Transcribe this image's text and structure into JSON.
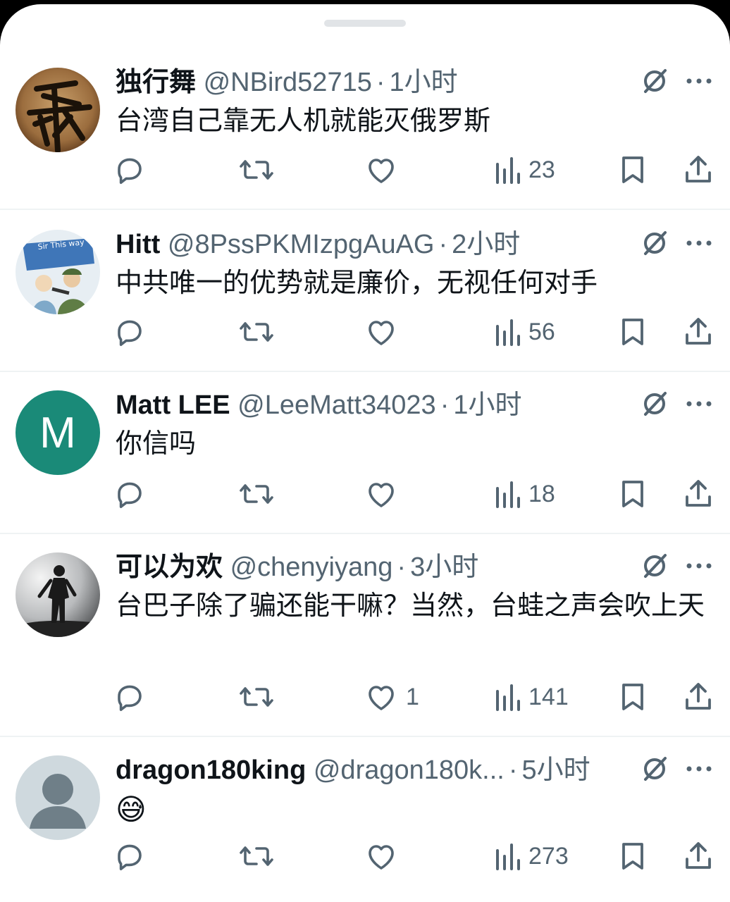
{
  "replies": [
    {
      "name": "独行舞",
      "handle": "@NBird52715",
      "time": "1小时",
      "text": "台湾自己靠无人机就能灭俄罗斯",
      "likes": "",
      "views": "23",
      "avatar_icon": "calligraphy-avatar"
    },
    {
      "name": "Hitt",
      "handle": "@8PssPKMIzpgAuAG",
      "time": "2小时",
      "text": "中共唯一的优势就是廉价，无视任何对手",
      "likes": "",
      "views": "56",
      "avatar_icon": "flag-cartoon-avatar",
      "avatar_text": "Sir This way"
    },
    {
      "name": "Matt LEE",
      "handle": "@LeeMatt34023",
      "time": "1小时",
      "text": "你信吗",
      "likes": "",
      "views": "18",
      "avatar_letter": "M",
      "avatar_color": "#1a8a78"
    },
    {
      "name": "可以为欢",
      "handle": "@chenyiyang",
      "time": "3小时",
      "text": "台巴子除了骗还能干嘛？当然，台蛙之声会吹上天",
      "likes": "1",
      "views": "141",
      "avatar_icon": "silhouette-photo-avatar"
    },
    {
      "name": "dragon180king",
      "handle": "@dragon180k...",
      "time": "5小时",
      "text": "😅",
      "likes": "",
      "views": "273",
      "avatar_icon": "default-user-avatar"
    }
  ],
  "colors": {
    "secondary": "#536471",
    "primary_text": "#0f1419",
    "divider": "#eff3f4"
  },
  "icons": [
    "reply-icon",
    "retweet-icon",
    "like-icon",
    "views-icon",
    "bookmark-icon",
    "share-icon",
    "grok-icon",
    "more-icon"
  ]
}
